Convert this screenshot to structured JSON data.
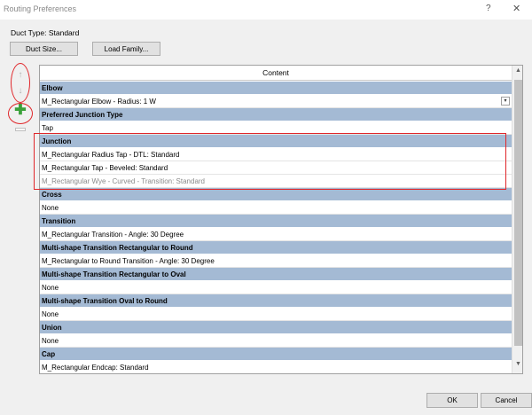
{
  "window": {
    "title": "Routing Preferences",
    "help_glyph": "?",
    "close_glyph": "✕"
  },
  "duct_type_label": "Duct Type: Standard",
  "toolbar": {
    "duct_size_label": "Duct Size...",
    "load_family_label": "Load Family..."
  },
  "tools": {
    "move_up_glyph": "↑",
    "move_down_glyph": "↓",
    "add_glyph": "✚"
  },
  "grid": {
    "header": "Content",
    "rows": [
      {
        "type": "section",
        "text": "Elbow"
      },
      {
        "type": "item",
        "text": "M_Rectangular Elbow - Radius: 1 W",
        "dropdown": true
      },
      {
        "type": "section",
        "text": "Preferred Junction Type"
      },
      {
        "type": "item",
        "text": "Tap"
      },
      {
        "type": "section",
        "text": "Junction"
      },
      {
        "type": "item",
        "text": "M_Rectangular Radius Tap - DTL: Standard"
      },
      {
        "type": "item",
        "text": "M_Rectangular Tap - Beveled: Standard"
      },
      {
        "type": "item",
        "text": "M_Rectangular Wye - Curved - Transition: Standard",
        "muted": true
      },
      {
        "type": "section",
        "text": "Cross"
      },
      {
        "type": "item",
        "text": "None"
      },
      {
        "type": "section",
        "text": "Transition"
      },
      {
        "type": "item",
        "text": "M_Rectangular Transition - Angle: 30 Degree"
      },
      {
        "type": "section",
        "text": "Multi-shape Transition Rectangular to Round"
      },
      {
        "type": "item",
        "text": "M_Rectangular to Round Transition - Angle: 30 Degree"
      },
      {
        "type": "section",
        "text": "Multi-shape Transition Rectangular to Oval"
      },
      {
        "type": "item",
        "text": "None"
      },
      {
        "type": "section",
        "text": "Multi-shape Transition Oval to Round"
      },
      {
        "type": "item",
        "text": "None"
      },
      {
        "type": "section",
        "text": "Union"
      },
      {
        "type": "item",
        "text": "None"
      },
      {
        "type": "section",
        "text": "Cap"
      },
      {
        "type": "item",
        "text": "M_Rectangular Endcap: Standard"
      }
    ],
    "dropdown_glyph": "▾",
    "scroll_up_glyph": "▲",
    "scroll_down_glyph": "▼"
  },
  "footer": {
    "ok_label": "OK",
    "cancel_label": "Cancel"
  },
  "colors": {
    "section_band": "#a4bad4",
    "annotation_red": "#e0262a",
    "add_green": "#3aa13a"
  }
}
